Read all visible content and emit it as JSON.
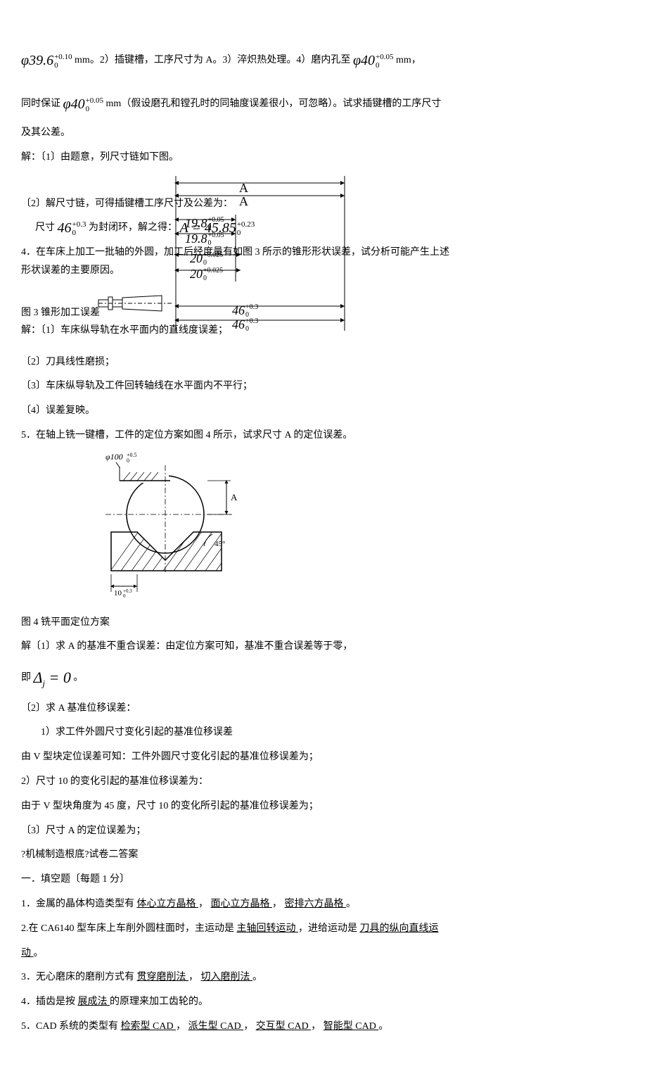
{
  "line1": {
    "formula1_main": "φ39.6",
    "formula1_top": "+0.10",
    "formula1_bot": "0",
    "text1": " mm。2）插键槽，工序尺寸为 A。3）淬炽热处理。4）磨内孔至 ",
    "formula2_main": "φ40",
    "formula2_top": "+0.05",
    "formula2_bot": "0",
    "text2": " mm，"
  },
  "line2": {
    "text1": "同时保证 ",
    "formula_main": "φ40",
    "formula_top": "+0.05",
    "formula_bot": "0",
    "text2": " mm（假设磨孔和镗孔时的同轴度误差很小，可忽略）。试求插键槽的工序尺寸"
  },
  "line3": "及其公差。",
  "line4": "解：〔1〕由题意，列尺寸链如下图。",
  "diagram": {
    "A1": "A",
    "A2": "A",
    "d198_1_main": "19.8",
    "d198_1_top": "+0.05",
    "d198_1_bot": "0",
    "d198_2_main": "19.8",
    "d198_2_top": "+0.05",
    "d198_2_bot": "0",
    "d20_1_main": "20",
    "d20_1_top": "+0.025",
    "d20_1_bot": "0",
    "d20_2_main": "20",
    "d20_2_top": "+0.025",
    "d20_2_bot": "0",
    "d46_1_main": "46",
    "d46_1_top": "+0.3",
    "d46_1_bot": "0",
    "d46_2_main": "46",
    "d46_2_top": "+0.3",
    "d46_2_bot": "0"
  },
  "line5": "〔2〕解尺寸链，可得插键槽工序尺寸及公差为：",
  "line6": {
    "text1": "尺寸 ",
    "f1_main": "46",
    "f1_top": "+0.3",
    "f1_bot": "0",
    "text2": " 为封闭环，解之得：",
    "f2_pre": "A = 45.85",
    "f2_top": "+0.23",
    "f2_bot": "0"
  },
  "line7": "4．在车床上加工一批轴的外圆，加工后经度量有如图 3 所示的锥形形状误差，试分析可能产生上述",
  "line8": "形状误差的主要原因。",
  "fig3_caption": "图 3 锥形加工误差",
  "line11_1": "解：〔1〕车床纵导轨在水平面内的直线度误差；",
  "line11_2": "〔2〕刀具线性磨损；",
  "line11_3": "〔3〕车床纵导轨及工件回转轴线在水平面内不平行；",
  "line11_4": "〔4〕误差复映。",
  "line12": "5．在轴上铣一键槽，工件的定位方案如图 4 所示，试求尺寸 A 的定位误差。",
  "fig4_caption": "图 4 铣平面定位方案",
  "vdiag": {
    "phi100_main": "φ100",
    "phi100_top": "+0.5",
    "phi100_bot": "0",
    "A": "A",
    "angle": "45°",
    "dim10_main": "10",
    "dim10_top": "+0.3",
    "dim10_bot": "0"
  },
  "line14": "解〔1〕求 A 的基准不重合误差：由定位方案可知，基准不重合误差等于零，",
  "line15": {
    "text1": "即 ",
    "formula": "Δ",
    "sub": "j",
    "eq": " = 0",
    "text2": " 。"
  },
  "line16": "〔2〕求 A 基准位移误差：",
  "line17": "1）求工件外圆尺寸变化引起的基准位移误差",
  "line18": "由 V 型块定位误差可知：工件外圆尺寸变化引起的基准位移误差为；",
  "line19": "2）尺寸 10 的变化引起的基准位移误差为：",
  "line20": "由于 V 型块角度为 45 度，尺寸 10 的变化所引起的基准位移误差为；",
  "line21": "〔3〕尺寸 A 的定位误差为；",
  "line22": "?机械制造根底?试卷二答案",
  "line23": "一．填空题〔每题 1 分〕",
  "line24": {
    "pre": "1．金属的晶体构造类型有 ",
    "u1": " 体心立方晶格 ",
    "m1": "， ",
    "u2": " 面心立方晶格 ",
    "m2": " ， ",
    "u3": " 密排六方晶格 ",
    "post": " 。"
  },
  "line25": {
    "pre": "2.在 CA6140 型车床上车削外圆柱面时，主运动是 ",
    "u1": " 主轴回转运动 ",
    "m1": "，进给运动是 ",
    "u2": " 刀具的纵向直线运"
  },
  "line26_u": "动 ",
  "line26_post": "。",
  "line27": {
    "pre": "3．无心磨床的磨削方式有 ",
    "u1": " 贯穿磨削法 ",
    "m1": "， ",
    "u2": " 切入磨削法 ",
    "post": " 。"
  },
  "line28": {
    "pre": "4．插齿是按 ",
    "u1": "    展成法    ",
    "post": " 的原理来加工齿轮的。"
  },
  "line29": {
    "pre": "5．CAD 系统的类型有 ",
    "u1": "检索型 CAD ",
    "m1": "， ",
    "u2": " 派生型 CAD ",
    "m2": "， ",
    "u3": " 交互型 CAD ",
    "m3": "， ",
    "u4": " 智能型 CAD ",
    "post": " 。"
  }
}
